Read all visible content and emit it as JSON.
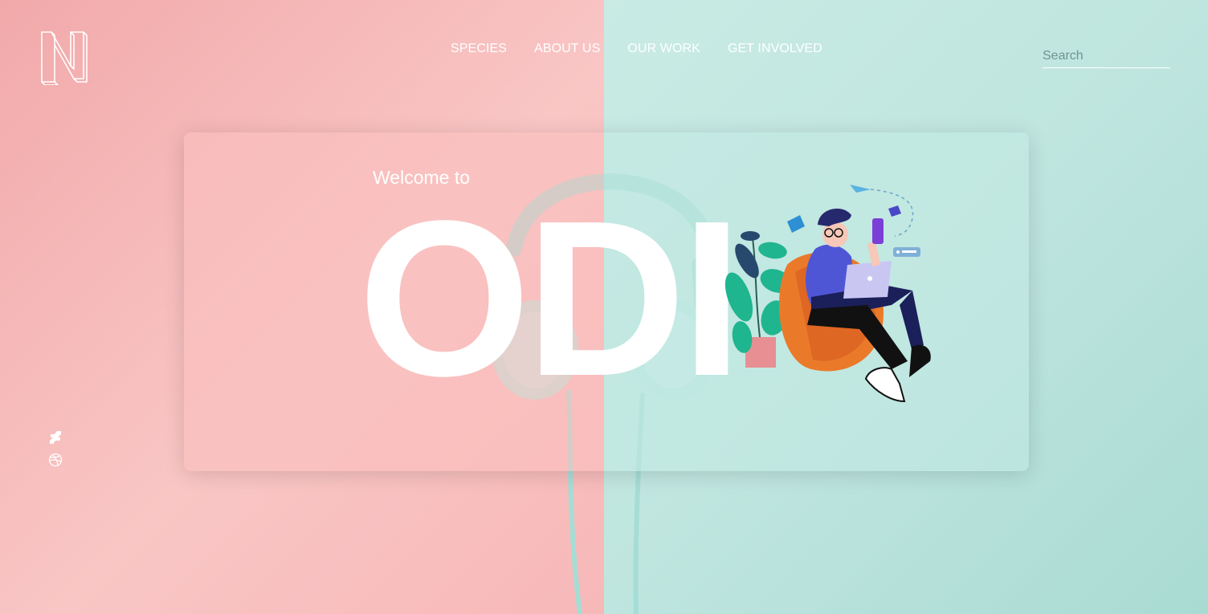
{
  "nav": {
    "items": [
      {
        "label": "SPECIES"
      },
      {
        "label": "ABOUT US"
      },
      {
        "label": "OUR WORK"
      },
      {
        "label": "GET INVOLVED"
      }
    ]
  },
  "search": {
    "placeholder": "Search",
    "value": ""
  },
  "hero": {
    "welcome": "Welcome to",
    "title": "ODI"
  },
  "social": {
    "icons": [
      "deviantart-icon",
      "dribbble-icon"
    ]
  },
  "colors": {
    "left_bg": "#f7b9b8",
    "right_bg": "#bfe5df",
    "headphone": "#9fdbd3",
    "text": "#ffffff"
  }
}
